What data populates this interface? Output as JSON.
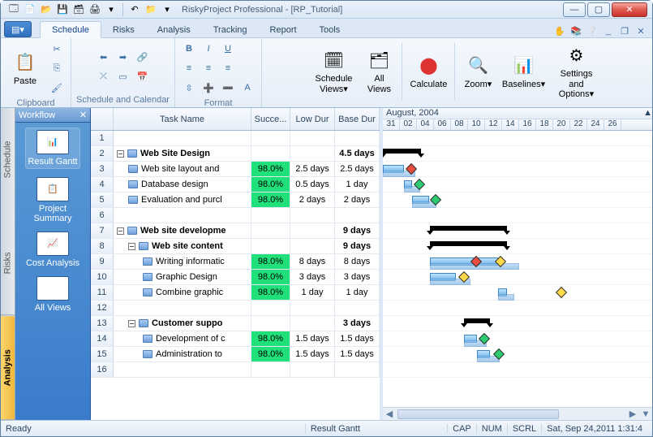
{
  "window": {
    "title": "RiskyProject Professional - [RP_Tutorial]"
  },
  "tabs": {
    "file": "⎘",
    "schedule": "Schedule",
    "risks": "Risks",
    "analysis": "Analysis",
    "tracking": "Tracking",
    "report": "Report",
    "tools": "Tools"
  },
  "ribbon": {
    "clipboard": {
      "paste": "Paste",
      "label": "Clipboard"
    },
    "schedcal": {
      "label": "Schedule and Calendar"
    },
    "format": {
      "label": "Format"
    },
    "views": {
      "schedule": "Schedule Views▾",
      "all": "All Views",
      "calculate": "Calculate",
      "zoom": "Zoom▾",
      "baselines": "Baselines▾",
      "settings": "Settings and Options▾"
    }
  },
  "workflow": {
    "title": "Workflow",
    "items": [
      {
        "label": "Result Gantt"
      },
      {
        "label": "Project Summary"
      },
      {
        "label": "Cost Analysis"
      },
      {
        "label": "All Views"
      }
    ]
  },
  "vtabs": {
    "schedule": "Schedule",
    "risks": "Risks",
    "analysis": "Analysis"
  },
  "grid": {
    "headers": {
      "name": "Task Name",
      "succ": "Succe...",
      "low": "Low Dur",
      "base": "Base Dur"
    },
    "rows": [
      {
        "n": "1",
        "name": "",
        "lvl": 0
      },
      {
        "n": "2",
        "name": "Web Site Design",
        "lvl": 0,
        "sum": true,
        "base": "4.5 days"
      },
      {
        "n": "3",
        "name": "Web site layout and",
        "lvl": 1,
        "succ": "98.0%",
        "low": "2.5 days",
        "base": "2.5 days"
      },
      {
        "n": "4",
        "name": "Database design",
        "lvl": 1,
        "succ": "98.0%",
        "low": "0.5 days",
        "base": "1 day"
      },
      {
        "n": "5",
        "name": "Evaluation and purcl",
        "lvl": 1,
        "succ": "98.0%",
        "low": "2 days",
        "base": "2 days"
      },
      {
        "n": "6",
        "name": "",
        "lvl": 0
      },
      {
        "n": "7",
        "name": "Web site developme",
        "lvl": 0,
        "sum": true,
        "base": "9 days"
      },
      {
        "n": "8",
        "name": "Web site content",
        "lvl": 1,
        "sum": true,
        "base": "9 days"
      },
      {
        "n": "9",
        "name": "Writing informatic",
        "lvl": 2,
        "succ": "98.0%",
        "low": "8 days",
        "base": "8 days"
      },
      {
        "n": "10",
        "name": "Graphic Design",
        "lvl": 2,
        "succ": "98.0%",
        "low": "3 days",
        "base": "3 days"
      },
      {
        "n": "11",
        "name": "Combine graphic",
        "lvl": 2,
        "succ": "98.0%",
        "low": "1 day",
        "base": "1 day"
      },
      {
        "n": "12",
        "name": "",
        "lvl": 0
      },
      {
        "n": "13",
        "name": "Customer suppo",
        "lvl": 1,
        "sum": true,
        "base": "3 days"
      },
      {
        "n": "14",
        "name": "Development of c",
        "lvl": 2,
        "succ": "98.0%",
        "low": "1.5 days",
        "base": "1.5 days"
      },
      {
        "n": "15",
        "name": "Administration to",
        "lvl": 2,
        "succ": "98.0%",
        "low": "1.5 days",
        "base": "1.5 days"
      },
      {
        "n": "16",
        "name": "",
        "lvl": 0
      }
    ]
  },
  "gantt": {
    "month": "August, 2004",
    "days": [
      "31",
      "02",
      "04",
      "06",
      "08",
      "10",
      "12",
      "14",
      "16",
      "18",
      "20",
      "22",
      "24",
      "26"
    ]
  },
  "status": {
    "ready": "Ready",
    "view": "Result Gantt",
    "cap": "CAP",
    "num": "NUM",
    "scrl": "SCRL",
    "datetime": "Sat, Sep 24,2011  1:31:4"
  }
}
